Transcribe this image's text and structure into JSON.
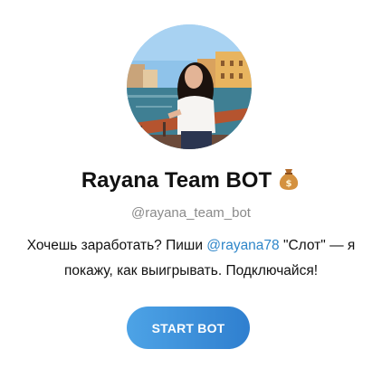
{
  "bot": {
    "name": "Rayana Team BOT",
    "title_icon": "money-bag-icon",
    "username": "@rayana_team_bot",
    "description": {
      "part1": "Хочешь заработать? Пиши ",
      "mention": "@rayana78",
      "part2": " \"Слот\" — я",
      "line2": "покажу, как выигрывать. Подключайся!"
    }
  },
  "actions": {
    "start_label": "START BOT"
  },
  "colors": {
    "accent": "#2e86c9",
    "button_start": "#4da3e6",
    "button_end": "#2f7fcf",
    "muted": "#8a8a8a"
  }
}
